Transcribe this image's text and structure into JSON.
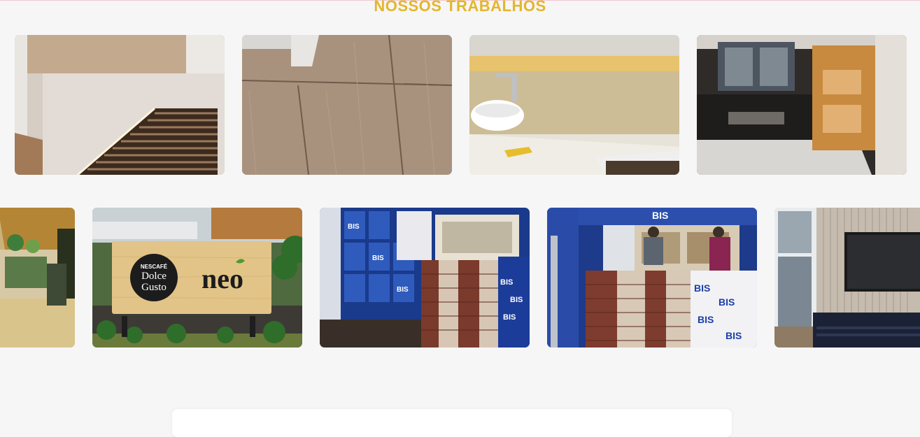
{
  "section": {
    "title": "NOSSOS TRABALHOS"
  },
  "gallery": {
    "row1": [
      {
        "name": "gallery-photo-wood-railing",
        "alt": "Painel em madeira com ripado iluminado"
      },
      {
        "name": "gallery-photo-wood-panels",
        "alt": "Painéis de madeira"
      },
      {
        "name": "gallery-photo-bathroom-vanity",
        "alt": "Bancada de banheiro com iluminação"
      },
      {
        "name": "gallery-photo-kitchen",
        "alt": "Cozinha com bancada de granito"
      }
    ],
    "row2": [
      {
        "name": "gallery-photo-store-interior",
        "alt": "Interior de loja"
      },
      {
        "name": "gallery-photo-neo-sign",
        "alt": "Placa Nescafé Dolce Gusto neo"
      },
      {
        "name": "gallery-photo-bis-kiosk-1",
        "alt": "Quiosque BIS"
      },
      {
        "name": "gallery-photo-bis-kiosk-2",
        "alt": "Quiosque BIS em montagem"
      },
      {
        "name": "gallery-photo-tv-room",
        "alt": "Sala com painel ripado e TV"
      }
    ]
  },
  "sign": {
    "brand_top": "NESCAFÉ",
    "brand_line1": "Dolce",
    "brand_line2": "Gusto",
    "product": "neo"
  },
  "kiosk": {
    "logo": "BIS"
  }
}
